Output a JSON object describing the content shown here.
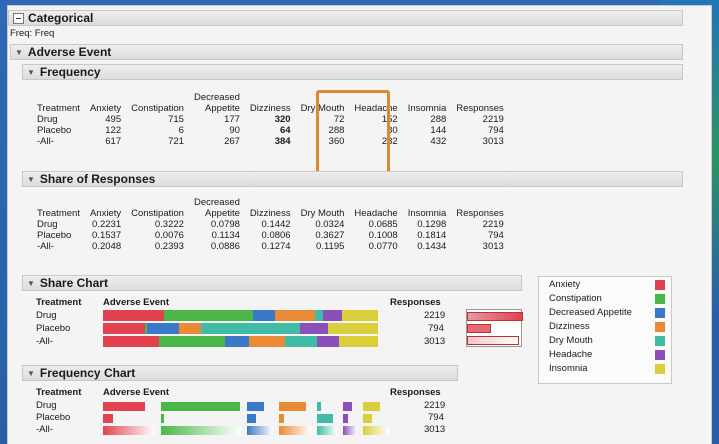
{
  "report": {
    "title": "Categorical",
    "freq": "Freq: Freq",
    "section": "Adverse Event"
  },
  "frequency": {
    "header": "Frequency",
    "columns": [
      "Treatment",
      "Anxiety",
      "Constipation",
      "Decreased Appetite",
      "Dizziness",
      "Dry Mouth",
      "Headache",
      "Insomnia",
      "Responses"
    ],
    "rows": [
      [
        "Drug",
        "495",
        "715",
        "177",
        "320",
        "72",
        "152",
        "288",
        "2219"
      ],
      [
        "Placebo",
        "122",
        "6",
        "90",
        "64",
        "288",
        "80",
        "144",
        "794"
      ],
      [
        "-All-",
        "617",
        "721",
        "267",
        "384",
        "360",
        "232",
        "432",
        "3013"
      ]
    ]
  },
  "share": {
    "header": "Share of Responses",
    "rows": [
      [
        "Drug",
        "0.2231",
        "0.3222",
        "0.0798",
        "0.1442",
        "0.0324",
        "0.0685",
        "0.1298",
        "2219"
      ],
      [
        "Placebo",
        "0.1537",
        "0.0076",
        "0.1134",
        "0.0806",
        "0.3627",
        "0.1008",
        "0.1814",
        "794"
      ],
      [
        "-All-",
        "0.2048",
        "0.2393",
        "0.0886",
        "0.1274",
        "0.1195",
        "0.0770",
        "0.1434",
        "3013"
      ]
    ]
  },
  "share_chart": {
    "header": "Share Chart",
    "treatment_label": "Treatment",
    "event_label": "Adverse Event",
    "responses_label": "Responses",
    "rows": [
      {
        "label": "Drug",
        "responses": "2219",
        "shares": [
          0.2231,
          0.3222,
          0.0798,
          0.1442,
          0.0324,
          0.0685,
          0.1298
        ]
      },
      {
        "label": "Placebo",
        "responses": "794",
        "shares": [
          0.1537,
          0.0076,
          0.1134,
          0.0806,
          0.3627,
          0.1008,
          0.1814
        ]
      },
      {
        "label": "-All-",
        "responses": "3013",
        "shares": [
          0.2048,
          0.2393,
          0.0886,
          0.1274,
          0.1195,
          0.077,
          0.1434
        ]
      }
    ]
  },
  "freq_chart": {
    "header": "Frequency Chart",
    "treatment_label": "Treatment",
    "event_label": "Adverse Event",
    "responses_label": "Responses",
    "rows": [
      {
        "label": "Drug",
        "responses": "2219"
      },
      {
        "label": "Placebo",
        "responses": "794"
      },
      {
        "label": "-All-",
        "responses": "3013"
      }
    ]
  },
  "legend": {
    "items": [
      {
        "label": "Anxiety",
        "color": "#e2424f"
      },
      {
        "label": "Constipation",
        "color": "#4bb748"
      },
      {
        "label": "Decreased Appetite",
        "color": "#3a79c8"
      },
      {
        "label": "Dizziness",
        "color": "#e98b35"
      },
      {
        "label": "Dry Mouth",
        "color": "#3fbba6"
      },
      {
        "label": "Headache",
        "color": "#8a4fb8"
      },
      {
        "label": "Insomnia",
        "color": "#d8cf3a"
      }
    ]
  }
}
